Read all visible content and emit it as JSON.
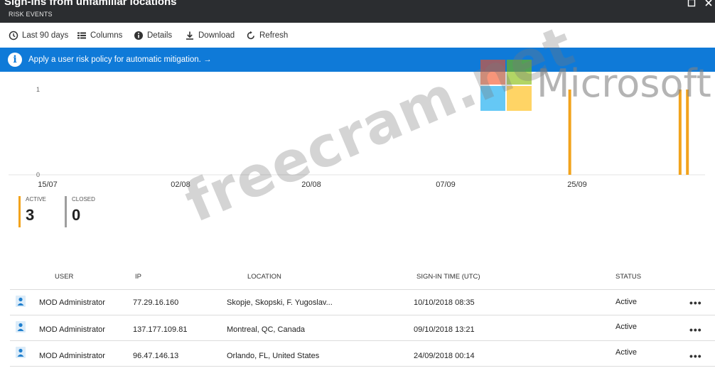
{
  "window": {
    "title": "Sign-ins from unfamiliar locations",
    "subtitle": "RISK EVENTS"
  },
  "toolbar": {
    "last90_label": "Last 90 days",
    "columns_label": "Columns",
    "details_label": "Details",
    "download_label": "Download",
    "refresh_label": "Refresh"
  },
  "banner": {
    "text": "Apply a user risk policy for automatic mitigation. →"
  },
  "chart_data": {
    "type": "bar",
    "x_tick_labels": [
      "15/07",
      "02/08",
      "20/08",
      "07/09",
      "25/09"
    ],
    "y_tick_labels": [
      "1",
      "0"
    ],
    "ylim": [
      0,
      1
    ],
    "bar_dates": [
      "24/09/2018",
      "09/10/2018",
      "10/10/2018"
    ],
    "values": [
      1,
      1,
      1
    ],
    "color": "#f2a31c"
  },
  "counters": {
    "active_label": "ACTIVE",
    "active_value": "3",
    "active_color": "#f2a31c",
    "closed_label": "CLOSED",
    "closed_value": "0",
    "closed_color": "#9e9e9e"
  },
  "table": {
    "headers": {
      "user": "USER",
      "ip": "IP",
      "location": "LOCATION",
      "signin_time": "SIGN-IN TIME (UTC)",
      "status": "STATUS"
    },
    "rows": [
      {
        "user": "MOD Administrator",
        "ip": "77.29.16.160",
        "location": "Skopje, Skopski, F. Yugoslav...",
        "signin_time": "10/10/2018 08:35",
        "status": "Active",
        "more": "•••"
      },
      {
        "user": "MOD Administrator",
        "ip": "137.177.109.81",
        "location": "Montreal, QC, Canada",
        "signin_time": "09/10/2018 13:21",
        "status": "Active",
        "more": "•••"
      },
      {
        "user": "MOD Administrator",
        "ip": "96.47.146.13",
        "location": "Orlando, FL, United States",
        "signin_time": "24/09/2018 00:14",
        "status": "Active",
        "more": "•••"
      }
    ]
  },
  "watermarks": {
    "site": "freecram.net",
    "brand": "Microsoft"
  }
}
